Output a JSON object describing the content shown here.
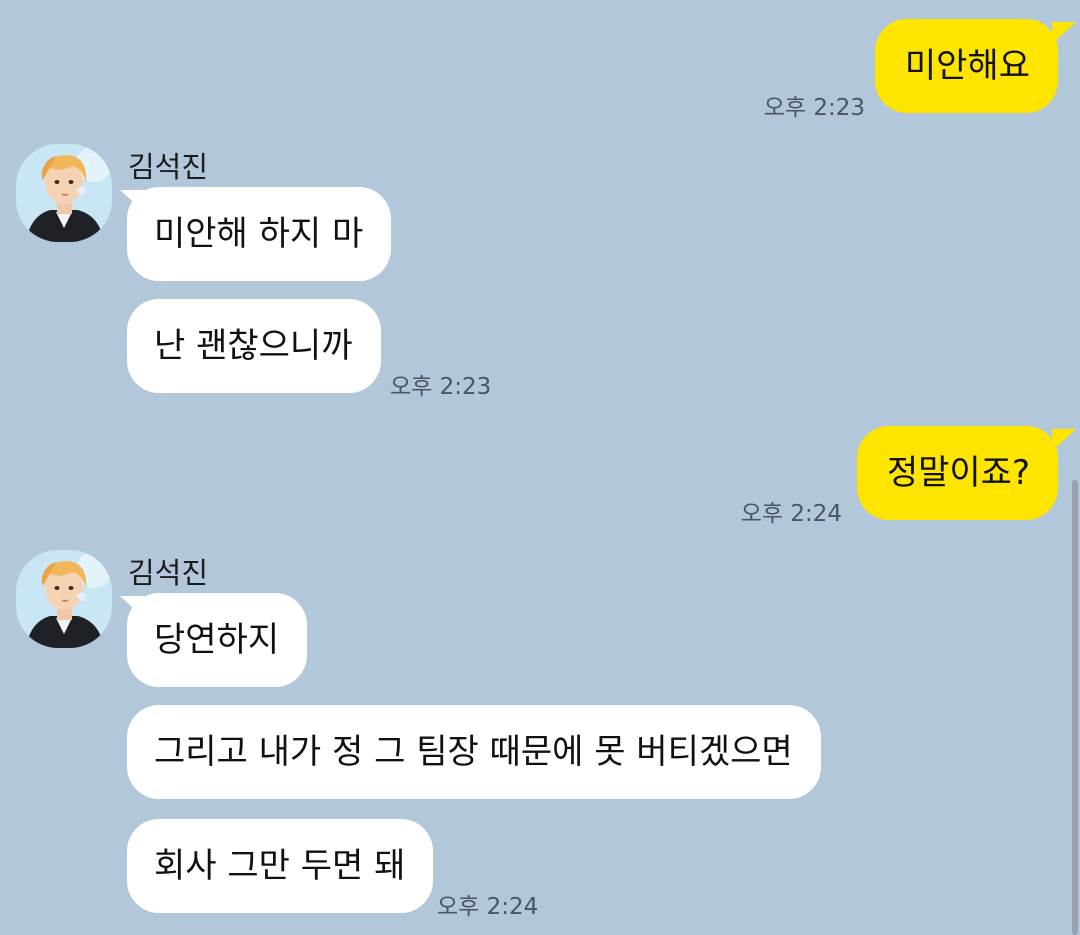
{
  "colors": {
    "background": "#b2c7da",
    "my_bubble": "#fee500",
    "their_bubble": "#ffffff",
    "timestamp": "#4a5560"
  },
  "messages": [
    {
      "from": "me",
      "text": "미안해요",
      "time": "오후 2:23"
    },
    {
      "from": "them",
      "sender": "김석진",
      "text": "미안해 하지 마"
    },
    {
      "from": "them",
      "text": "난 괜찮으니까",
      "time": "오후 2:23"
    },
    {
      "from": "me",
      "text": "정말이죠?",
      "time": "오후 2:24"
    },
    {
      "from": "them",
      "sender": "김석진",
      "text": "당연하지"
    },
    {
      "from": "them",
      "text": "그리고 내가 정 그 팀장 때문에 못 버티겠으면"
    },
    {
      "from": "them",
      "text": "회사 그만 두면 돼",
      "time": "오후 2:24"
    }
  ],
  "avatar_icon": "profile-photo-icon"
}
